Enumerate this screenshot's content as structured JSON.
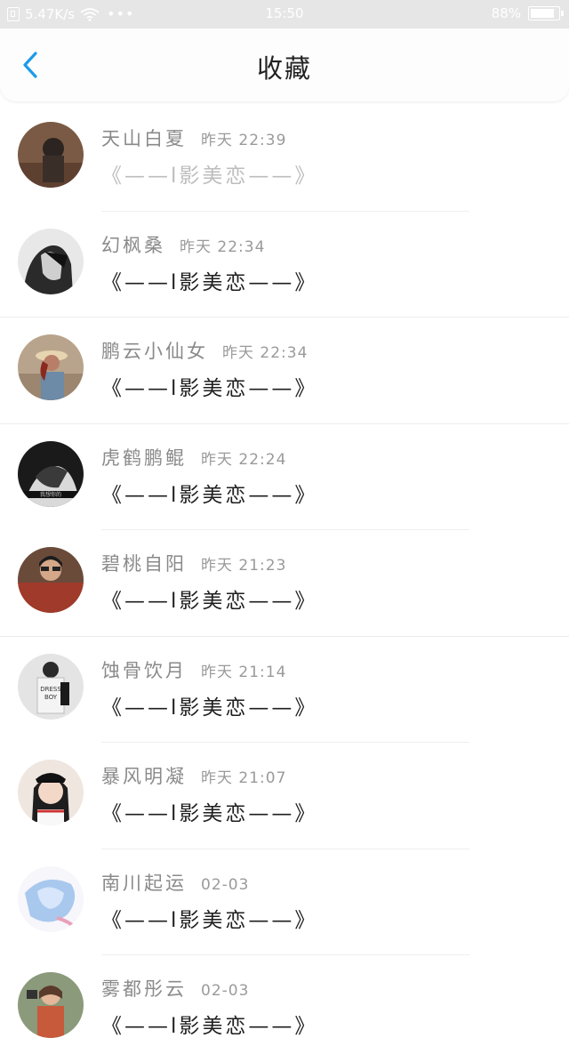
{
  "status_bar": {
    "net_speed": "5.47K/s",
    "dots": "•••",
    "time": "15:50",
    "battery": "88%",
    "battery_level": 0.88
  },
  "header": {
    "title": "收藏",
    "back_icon": "chevron-left-icon",
    "accent_color": "#1a9be8"
  },
  "favorites": [
    {
      "user": "天山白夏",
      "time": "昨天 22:39",
      "title": "《——l影美恋——》",
      "faded": true
    },
    {
      "user": "幻枫桑",
      "time": "昨天 22:34",
      "title": "《——l影美恋——》",
      "faded": false
    },
    {
      "user": "鹏云小仙女",
      "time": "昨天 22:34",
      "title": "《——l影美恋——》",
      "faded": false
    },
    {
      "user": "虎鹤鹏鲲",
      "time": "昨天 22:24",
      "title": "《——l影美恋——》",
      "faded": false
    },
    {
      "user": "碧桃自阳",
      "time": "昨天 21:23",
      "title": "《——l影美恋——》",
      "faded": false
    },
    {
      "user": "蚀骨饮月",
      "time": "昨天 21:14",
      "title": "《——l影美恋——》",
      "faded": false
    },
    {
      "user": "暴风明凝",
      "time": "昨天 21:07",
      "title": "《——l影美恋——》",
      "faded": false
    },
    {
      "user": "南川起运",
      "time": "02-03",
      "title": "《——l影美恋——》",
      "faded": false
    },
    {
      "user": "雾都彤云",
      "time": "02-03",
      "title": "《——l影美恋——》",
      "faded": false
    }
  ]
}
